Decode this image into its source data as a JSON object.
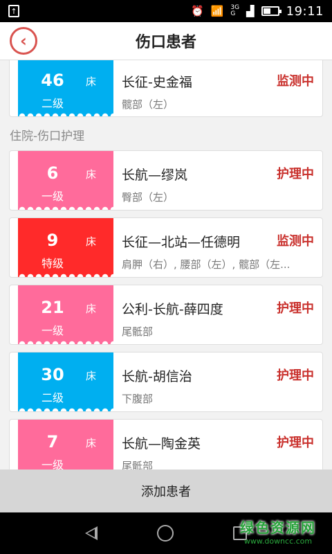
{
  "status_bar": {
    "time": "19:11",
    "network_top": "3G",
    "network_bottom": "G",
    "battery_percent": 45
  },
  "header": {
    "title": "伤口患者",
    "back_icon": "‹"
  },
  "first_card": {
    "bed": "46",
    "unit": "床",
    "level": "二级",
    "name": "长征-史金福",
    "part": "髋部（左）",
    "status": "监测中",
    "color": "#00aff0"
  },
  "group": {
    "title": "住院-伤口护理"
  },
  "patients": [
    {
      "bed": "6",
      "unit": "床",
      "level": "一级",
      "name": "长航—缪岚",
      "part": "臀部（左）",
      "status": "护理中",
      "color": "#ff6b9b"
    },
    {
      "bed": "9",
      "unit": "床",
      "level": "特级",
      "name": "长征—北站—任德明",
      "part": "肩胛（右）, 腰部（左）, 髋部（左...",
      "status": "监测中",
      "color": "#ff2a2a"
    },
    {
      "bed": "21",
      "unit": "床",
      "level": "一级",
      "name": "公利-长航-薛四度",
      "part": "尾骶部",
      "status": "护理中",
      "color": "#ff6b9b"
    },
    {
      "bed": "30",
      "unit": "床",
      "level": "二级",
      "name": "长航-胡信治",
      "part": "下腹部",
      "status": "护理中",
      "color": "#00aff0"
    },
    {
      "bed": "7",
      "unit": "床",
      "level": "一级",
      "name": "长航—陶金英",
      "part": "尾骶部",
      "status": "护理中",
      "color": "#ff6b9b"
    }
  ],
  "add_button": {
    "label": "添加患者"
  },
  "watermark": {
    "title": "绿色资源网",
    "url": "www.downcc.com"
  }
}
